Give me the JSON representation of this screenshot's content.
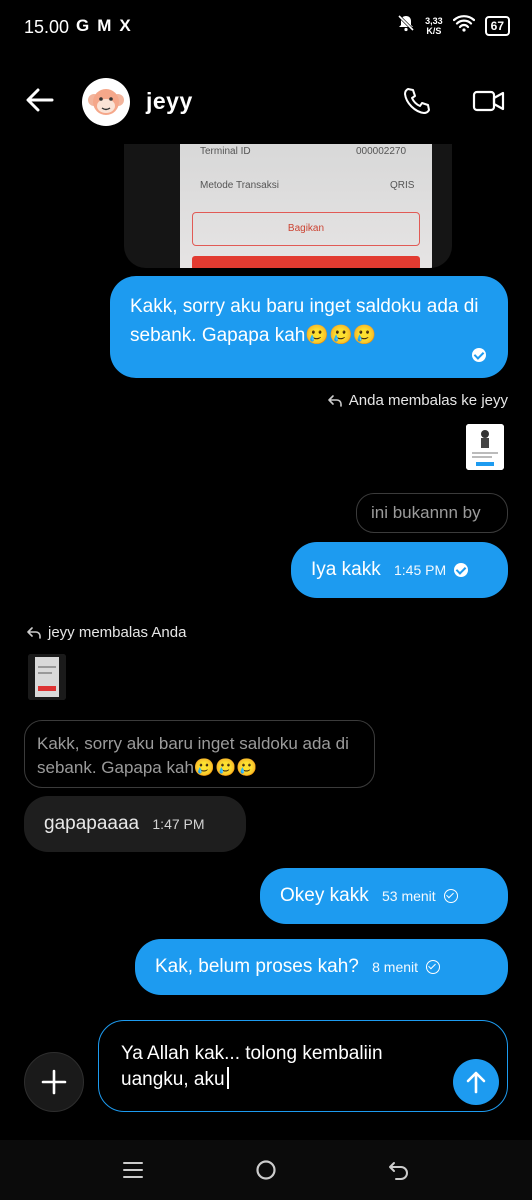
{
  "status_bar": {
    "time": "15.00",
    "app_icons": [
      "G",
      "M",
      "X"
    ],
    "speed_value": "3,33",
    "speed_unit": "K/S",
    "battery": "67"
  },
  "header": {
    "contact_name": "jeyy"
  },
  "photo_preview": {
    "row1_label": "Terminal ID",
    "row1_value": "000002270",
    "row2_label": "Metode Transaksi",
    "row2_value": "QRIS",
    "button_label": "Bagikan"
  },
  "messages": {
    "m1_text": "Kakk, sorry aku baru inget saldoku ada di sebank. Gapapa kah🥲🥲🥲",
    "reply_label_1": "Anda membalas ke jeyy",
    "quote_1": "ini bukannn by",
    "m2_text": "Iya kakk",
    "m2_time": "1:45 PM",
    "reply_label_2": "jeyy membalas Anda",
    "quote_2": "Kakk, sorry aku baru inget saldoku ada di sebank. Gapapa kah🥲🥲🥲",
    "m3_text": "gapapaaaa",
    "m3_time": "1:47 PM",
    "m4_text": "Okey kakk",
    "m4_time": "53 menit",
    "m5_text": "Kak, belum proses kah?",
    "m5_time": "8 menit"
  },
  "composer": {
    "value": "Ya Allah kak... tolong kembaliin uangku, aku"
  },
  "colors": {
    "accent": "#1d9bf0",
    "background": "#000000",
    "incoming_bubble": "#1e1e1e"
  }
}
